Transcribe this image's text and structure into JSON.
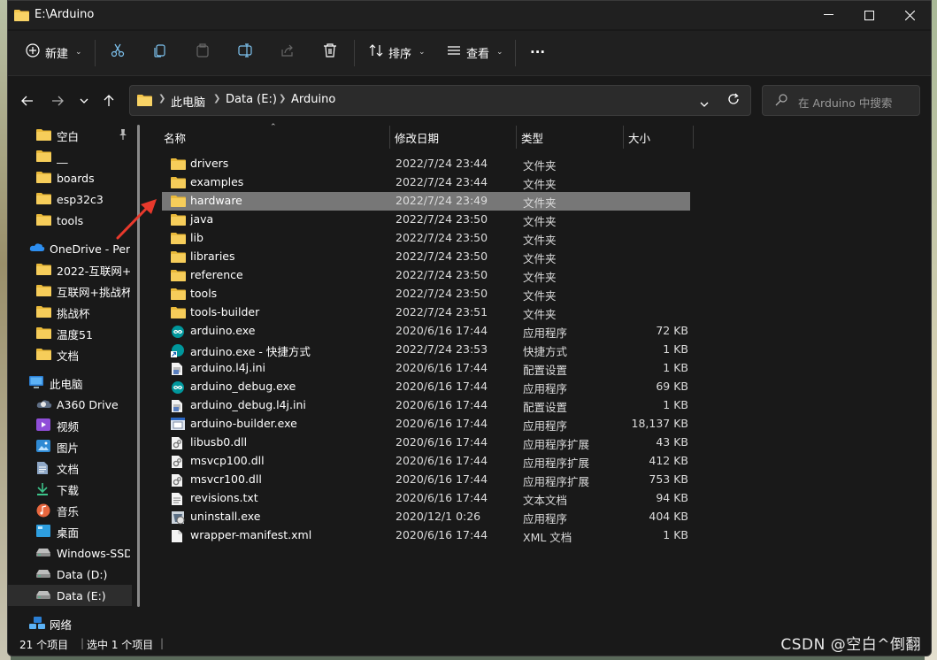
{
  "window": {
    "title": "E:\\Arduino"
  },
  "toolbar": {
    "new_label": "新建",
    "sort_label": "排序",
    "view_label": "查看",
    "more_label": "···"
  },
  "address": {
    "crumbs": [
      "此电脑",
      "Data (E:)",
      "Arduino"
    ],
    "search_placeholder": "在 Arduino 中搜索"
  },
  "sidebar": {
    "items": [
      {
        "label": "空白",
        "icon": "folder-icon",
        "pinned": true
      },
      {
        "label": "__",
        "icon": "folder-icon"
      },
      {
        "label": "boards",
        "icon": "folder-icon"
      },
      {
        "label": "esp32c3",
        "icon": "folder-icon"
      },
      {
        "label": "tools",
        "icon": "folder-icon"
      },
      {
        "label": "OneDrive - Pers",
        "icon": "onedrive-icon"
      },
      {
        "label": "2022-互联网+",
        "icon": "folder-icon"
      },
      {
        "label": "互联网+挑战杯",
        "icon": "folder-icon"
      },
      {
        "label": "挑战杯",
        "icon": "folder-icon"
      },
      {
        "label": "温度51",
        "icon": "folder-icon"
      },
      {
        "label": "文档",
        "icon": "folder-icon"
      },
      {
        "label": "此电脑",
        "icon": "pc-icon"
      },
      {
        "label": "A360 Drive",
        "icon": "a360-icon"
      },
      {
        "label": "视频",
        "icon": "video-icon"
      },
      {
        "label": "图片",
        "icon": "pictures-icon"
      },
      {
        "label": "文档",
        "icon": "documents-icon"
      },
      {
        "label": "下载",
        "icon": "download-icon"
      },
      {
        "label": "音乐",
        "icon": "music-icon"
      },
      {
        "label": "桌面",
        "icon": "desktop-icon"
      },
      {
        "label": "Windows-SSD",
        "icon": "drive-icon"
      },
      {
        "label": "Data (D:)",
        "icon": "drive-icon"
      },
      {
        "label": "Data (E:)",
        "icon": "drive-icon",
        "selected": true
      },
      {
        "label": "网络",
        "icon": "network-icon"
      }
    ]
  },
  "columns": {
    "name": "名称",
    "date": "修改日期",
    "type": "类型",
    "size": "大小"
  },
  "files": [
    {
      "name": "drivers",
      "date": "2022/7/24 23:44",
      "type": "文件夹",
      "size": "",
      "icon": "folder"
    },
    {
      "name": "examples",
      "date": "2022/7/24 23:44",
      "type": "文件夹",
      "size": "",
      "icon": "folder"
    },
    {
      "name": "hardware",
      "date": "2022/7/24 23:49",
      "type": "文件夹",
      "size": "",
      "icon": "folder",
      "selected": true
    },
    {
      "name": "java",
      "date": "2022/7/24 23:50",
      "type": "文件夹",
      "size": "",
      "icon": "folder"
    },
    {
      "name": "lib",
      "date": "2022/7/24 23:50",
      "type": "文件夹",
      "size": "",
      "icon": "folder"
    },
    {
      "name": "libraries",
      "date": "2022/7/24 23:50",
      "type": "文件夹",
      "size": "",
      "icon": "folder"
    },
    {
      "name": "reference",
      "date": "2022/7/24 23:50",
      "type": "文件夹",
      "size": "",
      "icon": "folder"
    },
    {
      "name": "tools",
      "date": "2022/7/24 23:50",
      "type": "文件夹",
      "size": "",
      "icon": "folder"
    },
    {
      "name": "tools-builder",
      "date": "2022/7/24 23:51",
      "type": "文件夹",
      "size": "",
      "icon": "folder"
    },
    {
      "name": "arduino.exe",
      "date": "2020/6/16 17:44",
      "type": "应用程序",
      "size": "72 KB",
      "icon": "arduino"
    },
    {
      "name": "arduino.exe - 快捷方式",
      "date": "2022/7/24 23:53",
      "type": "快捷方式",
      "size": "1 KB",
      "icon": "shortcut"
    },
    {
      "name": "arduino.l4j.ini",
      "date": "2020/6/16 17:44",
      "type": "配置设置",
      "size": "1 KB",
      "icon": "ini"
    },
    {
      "name": "arduino_debug.exe",
      "date": "2020/6/16 17:44",
      "type": "应用程序",
      "size": "69 KB",
      "icon": "arduino"
    },
    {
      "name": "arduino_debug.l4j.ini",
      "date": "2020/6/16 17:44",
      "type": "配置设置",
      "size": "1 KB",
      "icon": "ini"
    },
    {
      "name": "arduino-builder.exe",
      "date": "2020/6/16 17:44",
      "type": "应用程序",
      "size": "18,137 KB",
      "icon": "exe"
    },
    {
      "name": "libusb0.dll",
      "date": "2020/6/16 17:44",
      "type": "应用程序扩展",
      "size": "43 KB",
      "icon": "dll"
    },
    {
      "name": "msvcp100.dll",
      "date": "2020/6/16 17:44",
      "type": "应用程序扩展",
      "size": "412 KB",
      "icon": "dll"
    },
    {
      "name": "msvcr100.dll",
      "date": "2020/6/16 17:44",
      "type": "应用程序扩展",
      "size": "753 KB",
      "icon": "dll"
    },
    {
      "name": "revisions.txt",
      "date": "2020/6/16 17:44",
      "type": "文本文档",
      "size": "94 KB",
      "icon": "txt"
    },
    {
      "name": "uninstall.exe",
      "date": "2020/12/1 0:26",
      "type": "应用程序",
      "size": "404 KB",
      "icon": "uninstall"
    },
    {
      "name": "wrapper-manifest.xml",
      "date": "2020/6/16 17:44",
      "type": "XML 文档",
      "size": "1 KB",
      "icon": "xml"
    }
  ],
  "status": {
    "count": "21 个项目",
    "selected": "选中 1 个项目"
  },
  "watermark": "CSDN @空白^倒翻",
  "colors": {
    "background": "#191919",
    "selection": "#777777",
    "folder": "#f4c54a",
    "arrow": "#e8392c"
  }
}
